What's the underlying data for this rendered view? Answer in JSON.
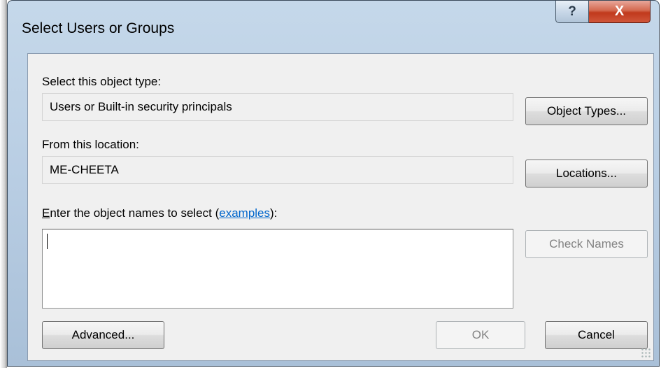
{
  "dialog": {
    "title": "Select Users or Groups",
    "help_glyph": "?",
    "close_glyph": "X"
  },
  "object_type": {
    "label": "Select this object type:",
    "value": "Users or Built-in security principals",
    "button": "Object Types..."
  },
  "location": {
    "label": "From this location:",
    "value": "ME-CHEETA",
    "button": "Locations..."
  },
  "names": {
    "label_accel": "E",
    "label_rest": "nter the object names to select (",
    "link": "examples",
    "label_end": "):",
    "value": "",
    "check_button": "Check Names"
  },
  "footer": {
    "advanced": "Advanced...",
    "ok": "OK",
    "cancel": "Cancel"
  }
}
